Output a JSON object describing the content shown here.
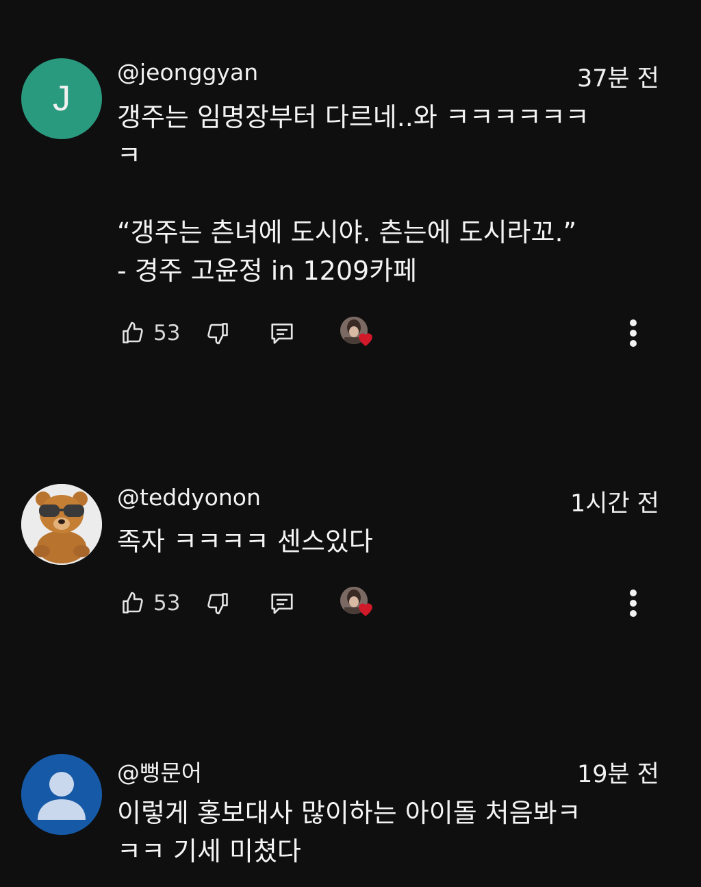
{
  "comments": [
    {
      "handle": "@jeonggyan",
      "time": "37분 전",
      "avatar_letter": "J",
      "avatar_color": "#2a9a7f",
      "lines": [
        "갱주는 임명장부터 다르네..와 ㅋㅋㅋㅋㅋㅋ",
        "ㅋ",
        "",
        "“갱주는 츤녀에 도시야. 츤는에 도시라꼬.”",
        "- 경주 고윤정 in 1209카페"
      ],
      "likes": "53"
    },
    {
      "handle": "@teddyonon",
      "time": "1시간 전",
      "lines": [
        "족자 ㅋㅋㅋㅋ 센스있다"
      ],
      "likes": "53"
    },
    {
      "handle": "@뻥문어",
      "time": "19분 전",
      "avatar_color": "#1659a6",
      "lines": [
        "이렇게 홍보대사 많이하는 아이돌 처음봐ㅋ",
        "ㅋㅋ 기세 미쳤다"
      ]
    }
  ],
  "icons": {
    "like": "thumb-up-icon",
    "dislike": "thumb-down-icon",
    "reply": "reply-icon",
    "creator_heart": "creator-heart-icon",
    "more": "more-vert-icon"
  },
  "colors": {
    "background": "#0f0f0f",
    "text": "#f1f1f1",
    "heart": "#d2192a"
  }
}
